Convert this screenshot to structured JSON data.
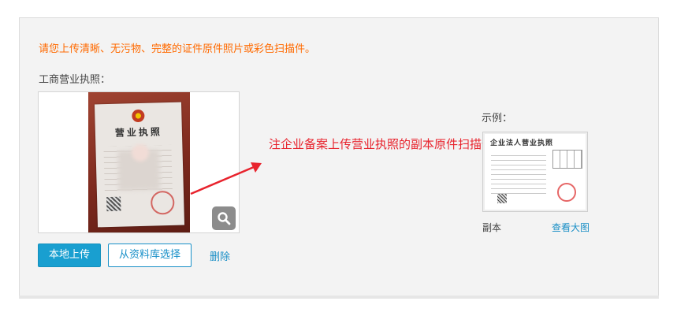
{
  "form": {
    "notice": "请您上传清晰、无污物、完整的证件原件照片或彩色扫描件。",
    "field_label": "工商营业执照：",
    "preview": {
      "document_title": "营业执照",
      "zoom_icon": "magnifier-icon"
    },
    "annotation": "注企业备案上传营业执照的副本原件扫描件",
    "example": {
      "label": "示例：",
      "thumb_title": "企业法人营业执照",
      "caption": "副本",
      "view_large": "查看大图"
    },
    "actions": {
      "local_upload": "本地上传",
      "select_from_library": "从资料库选择",
      "delete": "删除"
    }
  },
  "colors": {
    "notice": "#ff6a00",
    "annotation": "#e8232d",
    "primary": "#199fd0",
    "link": "#1a8fc6"
  }
}
